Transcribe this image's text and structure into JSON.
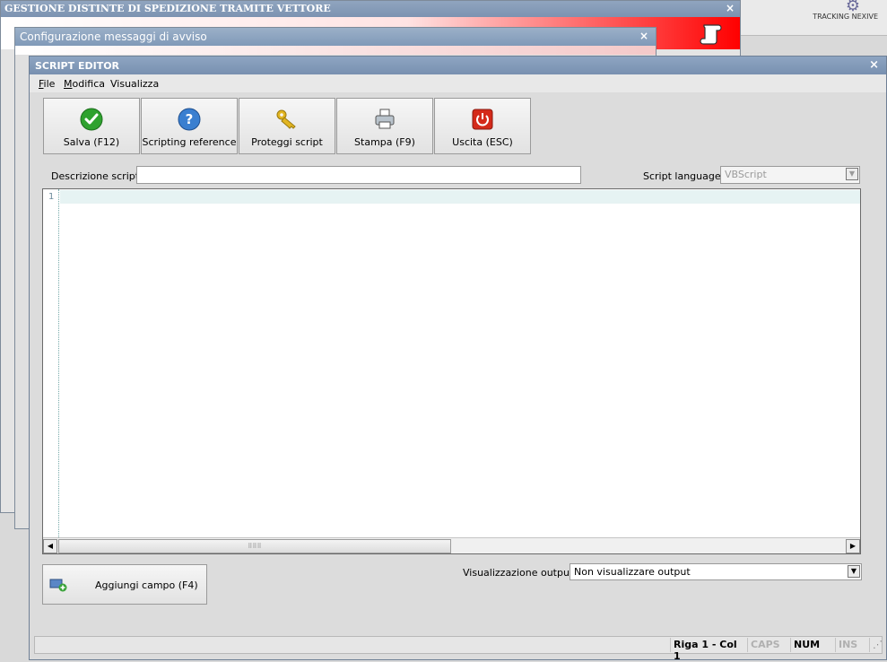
{
  "background": {
    "window1_title": "GESTIONE DISTINTE DI SPEDIZIONE TRAMITE VETTORE",
    "window2_title": "Configurazione messaggi di avviso",
    "right_label": "TRACKING NEXIVE",
    "close_glyph": "×"
  },
  "editor_window": {
    "title": "SCRIPT EDITOR",
    "close_glyph": "×",
    "menu": [
      {
        "mnemonic": "F",
        "rest": "ile"
      },
      {
        "mnemonic": "M",
        "rest": "odifica"
      },
      {
        "mnemonic": "",
        "rest": "Visualizza"
      }
    ],
    "toolbar": [
      {
        "label": "Salva (F12)",
        "icon": "check-icon"
      },
      {
        "label": "Scripting reference",
        "icon": "help-icon"
      },
      {
        "label": "Proteggi script",
        "icon": "key-icon"
      },
      {
        "label": "Stampa (F9)",
        "icon": "printer-icon"
      },
      {
        "label": "Uscita (ESC)",
        "icon": "power-icon"
      }
    ],
    "description_label": "Descrizione script :",
    "description_value": "",
    "language_label": "Script language :",
    "language_value": "VBScript",
    "editor": {
      "line_numbers": [
        "1"
      ],
      "content": ""
    },
    "add_field_label": "Aggiungi campo (F4)",
    "output_label": "Visualizzazione output :",
    "output_value": "Non visualizzare output",
    "status": {
      "position": "Riga 1 - Col 1",
      "caps": "CAPS",
      "num": "NUM",
      "ins": "INS"
    }
  },
  "colors": {
    "titlebar": "#7890b0",
    "banner_red": "#ff0000",
    "check_green": "#2fa22f",
    "help_blue": "#3a7fd0",
    "key_gold": "#e2b521",
    "power_red": "#d42a1a"
  }
}
